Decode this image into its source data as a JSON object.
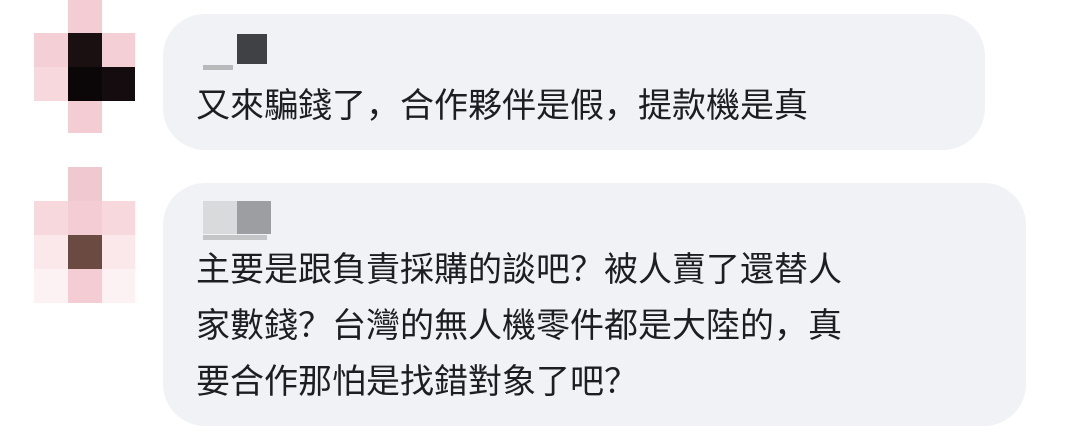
{
  "comments": [
    {
      "author": "",
      "lines": [
        "又來騙錢了，合作夥伴是假，提款機是真"
      ]
    },
    {
      "author": "",
      "lines": [
        "主要是跟負責採購的談吧？被人賣了還替人",
        "家數錢？台灣的無人機零件都是大陸的，真",
        "要合作那怕是找錯對象了吧？"
      ]
    }
  ],
  "colors": {
    "bubble": "#f0f2f5",
    "text": "#1c1e21",
    "background": "#ffffff"
  }
}
